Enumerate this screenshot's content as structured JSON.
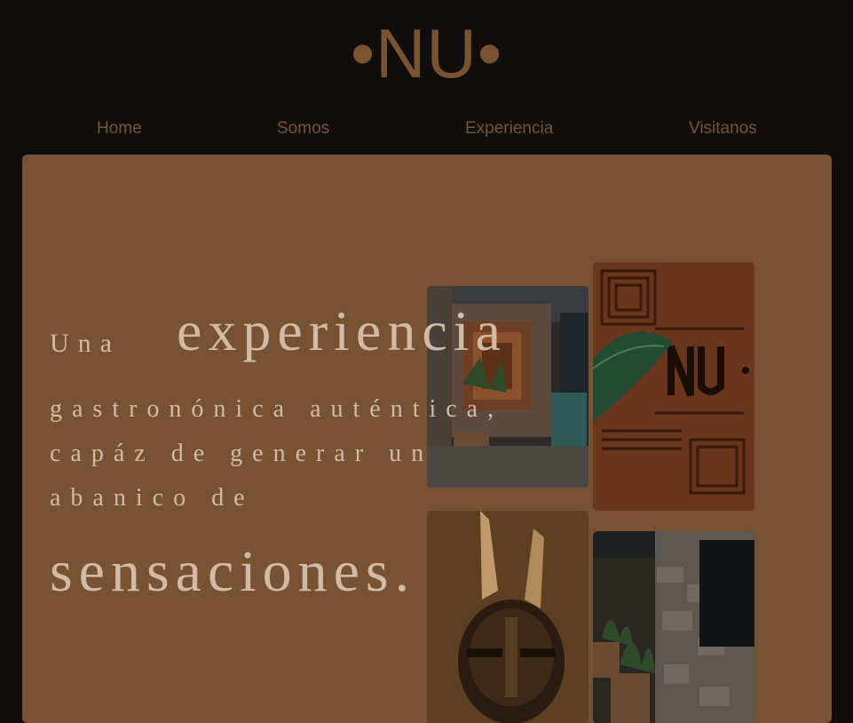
{
  "brand": {
    "logo_text": "•NU•"
  },
  "nav": {
    "items": [
      {
        "label": "Home"
      },
      {
        "label": "Somos"
      },
      {
        "label": "Experiencia"
      },
      {
        "label": "Visitanos"
      }
    ]
  },
  "hero": {
    "headline": {
      "part1": "Una",
      "part2": "experiencia",
      "line2": "gastronónica auténtica,",
      "line3": "capáz de generar un",
      "line4": "abanico de",
      "line5": "sensaciones."
    }
  },
  "colors": {
    "page_background": "#100e0d",
    "brand_brown": "#7a5431",
    "hero_background": "#775233",
    "headline_text": "#d2bba6"
  }
}
